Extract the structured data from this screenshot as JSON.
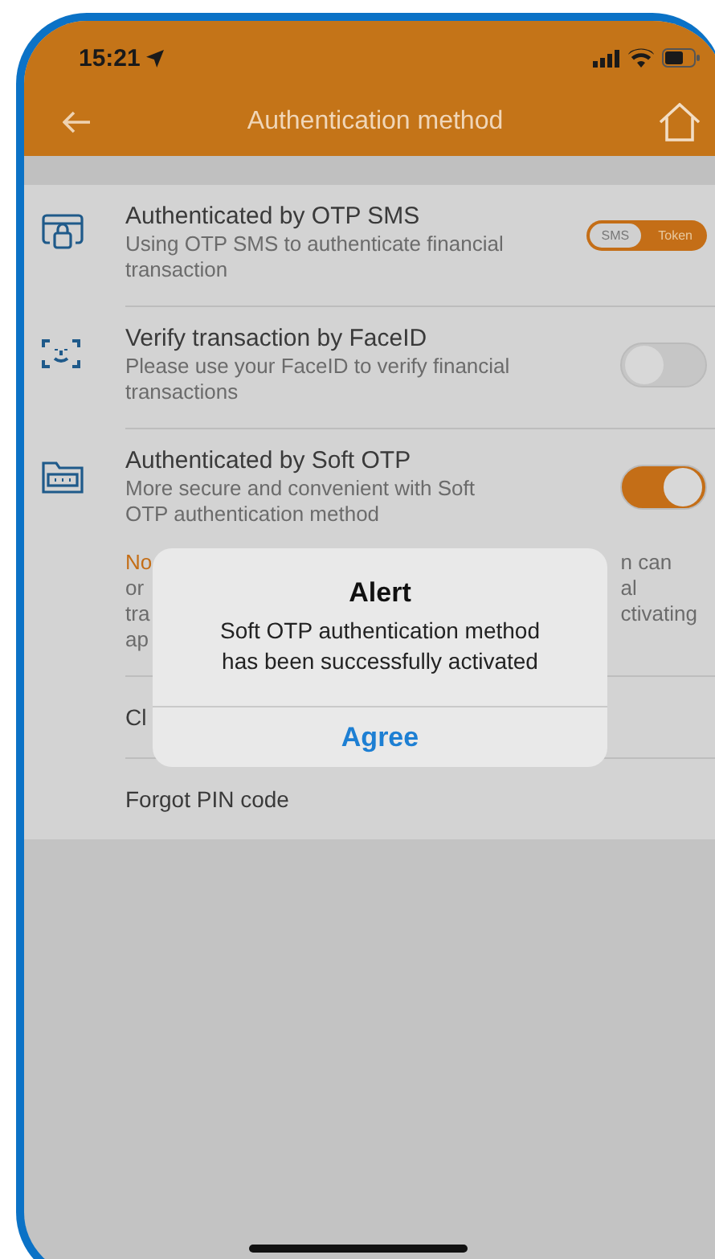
{
  "status_bar": {
    "time": "15:21"
  },
  "header": {
    "title": "Authentication method"
  },
  "methods": [
    {
      "kind": "segmented",
      "title": "Authenticated by OTP SMS",
      "description": "Using OTP SMS to authenticate financial\ntransaction",
      "options": [
        {
          "label": "SMS",
          "selected": true
        },
        {
          "label": "Token",
          "selected": false
        }
      ]
    },
    {
      "kind": "switch",
      "title": "Verify transaction by FaceID",
      "description": " Please use your FaceID to verify financial\ntransactions",
      "on": false
    },
    {
      "kind": "switch",
      "title": "Authenticated by Soft OTP",
      "description": "More secure and convenient with Soft\nOTP authentication method",
      "on": true,
      "note_left": [
        "No",
        "or",
        "tra",
        "ap"
      ],
      "note_right": [
        "n can",
        "al",
        "ctivating"
      ]
    }
  ],
  "links": [
    {
      "label": "Cl"
    },
    {
      "label": "Forgot PIN code"
    }
  ],
  "alert": {
    "title": "Alert",
    "message": "Soft OTP authentication method\nhas been successfully activated",
    "button": "Agree"
  }
}
